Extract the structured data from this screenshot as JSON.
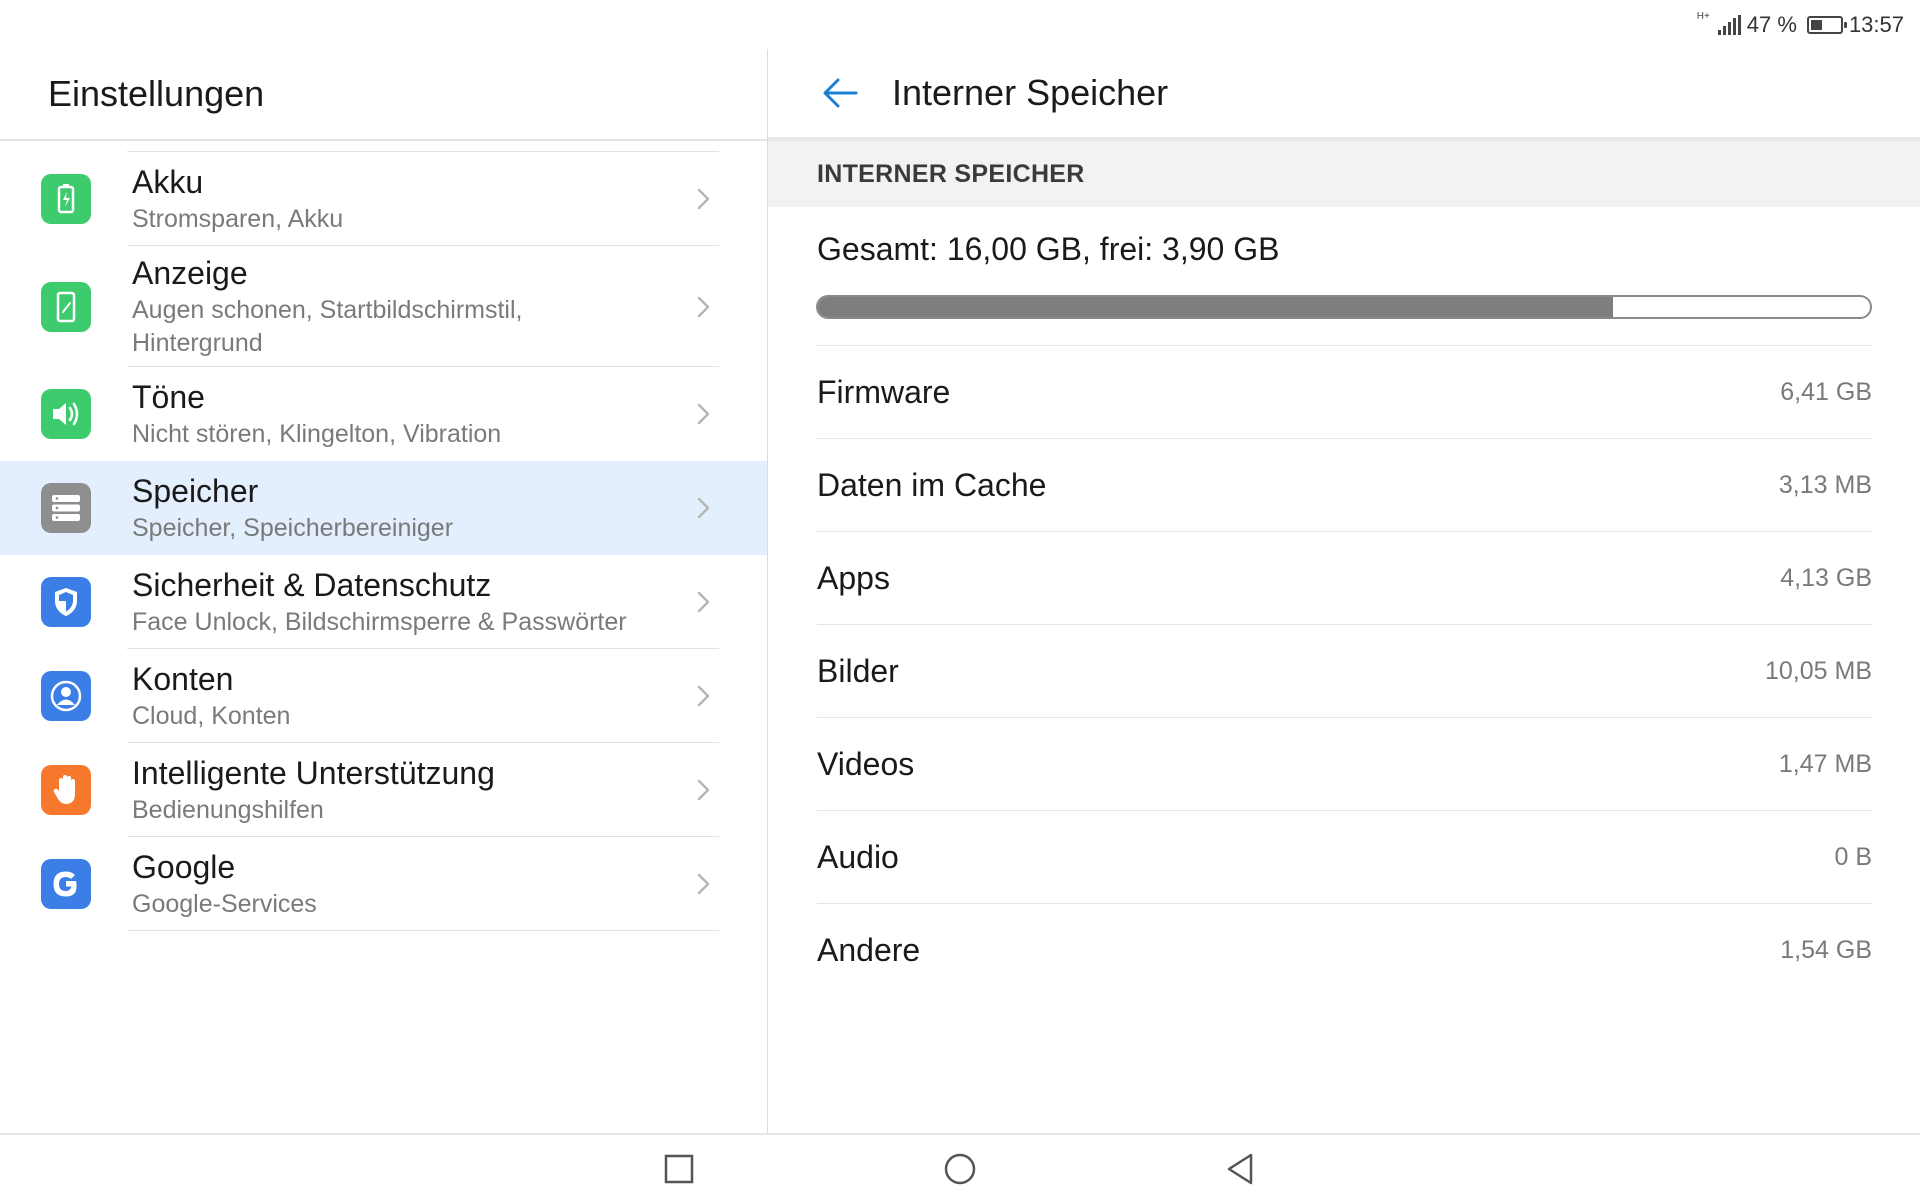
{
  "status_bar": {
    "network_tag": "H+",
    "battery_percent_label": "47 %",
    "battery_level": 0.47,
    "time": "13:57"
  },
  "left_pane": {
    "title": "Einstellungen",
    "items": [
      {
        "title": "Akku",
        "subtitle": "Stromsparen, Akku",
        "icon": "battery-icon",
        "color": "#3dcb6e",
        "selected": false
      },
      {
        "title": "Anzeige",
        "subtitle": "Augen schonen, Startbildschirmstil, Hintergrund",
        "icon": "display-icon",
        "color": "#3dcb6e",
        "selected": false
      },
      {
        "title": "Töne",
        "subtitle": "Nicht stören, Klingelton, Vibration",
        "icon": "speaker-icon",
        "color": "#3dcb6e",
        "selected": false
      },
      {
        "title": "Speicher",
        "subtitle": "Speicher, Speicherbereiniger",
        "icon": "storage-icon",
        "color": "#8e8e8e",
        "selected": true
      },
      {
        "title": "Sicherheit & Datenschutz",
        "subtitle": "Face Unlock, Bildschirmsperre & Passwörter",
        "icon": "shield-icon",
        "color": "#3b7fe6",
        "selected": false
      },
      {
        "title": "Konten",
        "subtitle": "Cloud, Konten",
        "icon": "account-icon",
        "color": "#3b7fe6",
        "selected": false
      },
      {
        "title": "Intelligente Unterstützung",
        "subtitle": "Bedienungshilfen",
        "icon": "hand-icon",
        "color": "#f5782d",
        "selected": false
      },
      {
        "title": "Google",
        "subtitle": "Google-Services",
        "icon": "google-icon",
        "color": "#3b7fe6",
        "selected": false
      }
    ]
  },
  "right_pane": {
    "title": "Interner Speicher",
    "section_label": "INTERNER SPEICHER",
    "summary": "Gesamt: 16,00 GB, frei: 3,90 GB",
    "used_fraction": 0.756,
    "rows": [
      {
        "label": "Firmware",
        "value": "6,41 GB"
      },
      {
        "label": "Daten im Cache",
        "value": "3,13 MB"
      },
      {
        "label": "Apps",
        "value": "4,13 GB"
      },
      {
        "label": "Bilder",
        "value": "10,05 MB"
      },
      {
        "label": "Videos",
        "value": "1,47 MB"
      },
      {
        "label": "Audio",
        "value": "0 B"
      },
      {
        "label": "Andere",
        "value": "1,54 GB"
      }
    ]
  },
  "colors": {
    "accent": "#1a7fd4",
    "selected_bg": "#e3effd"
  }
}
